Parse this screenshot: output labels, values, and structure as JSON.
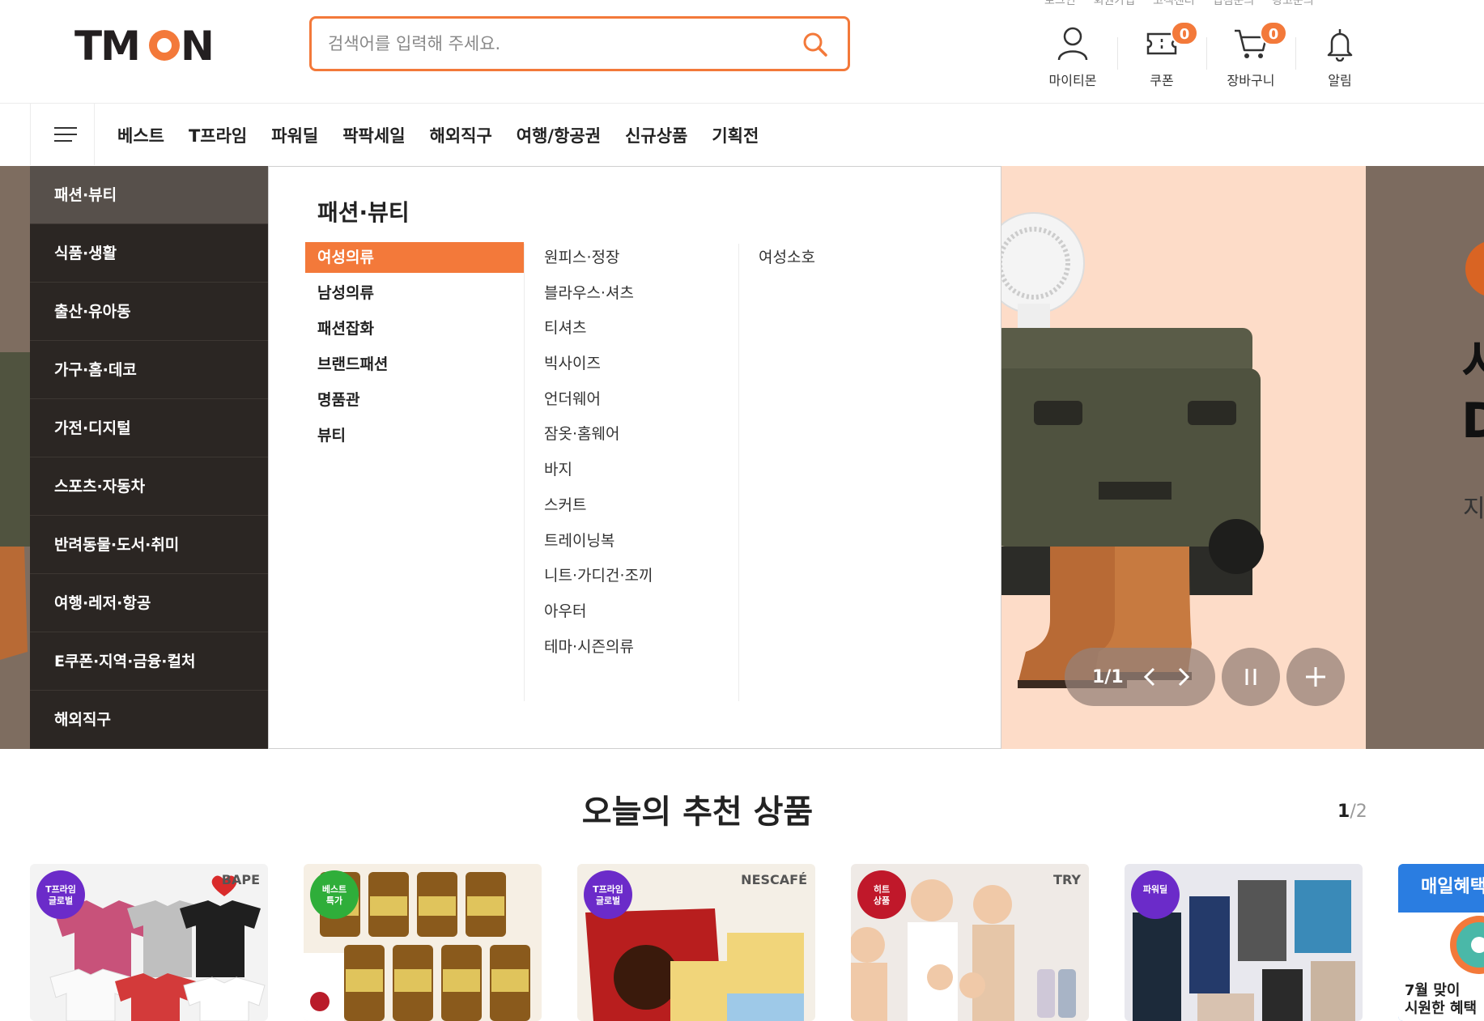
{
  "header": {
    "logo_text": "TMON",
    "util_links": [
      "로그인",
      "회원가입",
      "고객센터",
      "입점문의",
      "광고문의"
    ],
    "search_placeholder": "검색어를 입력해 주세요.",
    "icons": [
      {
        "label": "마이티몬",
        "icon": "user-icon"
      },
      {
        "label": "쿠폰",
        "icon": "coupon-icon",
        "badge": "0"
      },
      {
        "label": "장바구니",
        "icon": "cart-icon",
        "badge": "0"
      },
      {
        "label": "알림",
        "icon": "bell-icon"
      }
    ]
  },
  "nav": {
    "tabs": [
      "베스트",
      "T프라임",
      "파워딜",
      "팍팍세일",
      "해외직구",
      "여행/항공권",
      "신규상품",
      "기획전"
    ]
  },
  "categories": {
    "items": [
      "패션·뷰티",
      "식품·생활",
      "출산·유아동",
      "가구·홈·데코",
      "가전·디지털",
      "스포츠·자동차",
      "반려동물·도서·취미",
      "여행·레저·항공",
      "E쿠폰·지역·금융·컬처",
      "해외직구"
    ],
    "active": "패션·뷰티"
  },
  "panel": {
    "title": "패션·뷰티",
    "col1": [
      "여성의류",
      "남성의류",
      "패션잡화",
      "브랜드패션",
      "명품관",
      "뷰티"
    ],
    "col2": [
      "원피스·정장",
      "블라우스·셔츠",
      "티셔츠",
      "빅사이즈",
      "언더웨어",
      "잠옷·홈웨어",
      "바지",
      "스커트",
      "트레이닝복",
      "니트·가디건·조끼",
      "아우터",
      "테마·시즌의류"
    ],
    "col3": [
      "여성소호"
    ]
  },
  "banner": {
    "pager_text": "1/1",
    "right_big_1": "서",
    "right_big_2": "D",
    "right_small": "지"
  },
  "recommend": {
    "title": "오늘의 추천 상품",
    "page_current": "1",
    "page_total": "/2",
    "cards": [
      {
        "badge": "T프라임\n글로벌",
        "badge_color": "#6b2bc9",
        "bg": "#f3f3f3",
        "brand": "BAPE"
      },
      {
        "badge": "베스트\n특가",
        "badge_color": "#2fae3a",
        "bg": "#f6efe4",
        "brand": ""
      },
      {
        "badge": "T프라임\n글로벌",
        "badge_color": "#6b2bc9",
        "bg": "#f4efe6",
        "brand": "NESCAFÉ"
      },
      {
        "badge": "히트\n상품",
        "badge_color": "#c0182a",
        "bg": "#efeae6",
        "brand": "TRY"
      },
      {
        "badge": "파워딜",
        "badge_color": "#6b2bc9",
        "bg": "#e8e8ee",
        "brand": ""
      },
      {
        "badge": "",
        "badge_color": "#2a8be8",
        "bg": "#2a7de1",
        "brand": "매일혜택"
      }
    ],
    "card_last_text": "7월 맞이\n시원한 혜택"
  },
  "colors": {
    "accent": "#f3793a",
    "sidebar_bg": "#2b2623",
    "banner_bg": "#fddcc8"
  }
}
